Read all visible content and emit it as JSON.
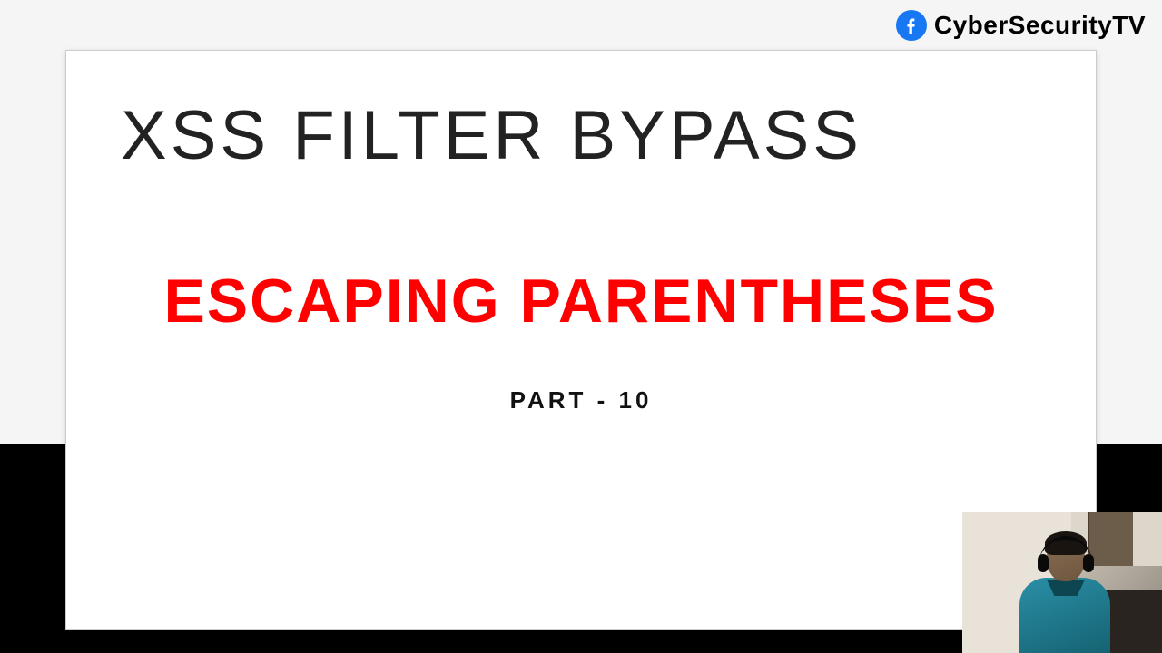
{
  "header": {
    "brand": "CyberSecurityTV",
    "icon": "facebook-icon"
  },
  "slide": {
    "title": "XSS FILTER BYPASS",
    "subtitle": "ESCAPING PARENTHESES",
    "part": "PART - 10"
  },
  "colors": {
    "accent_red": "#ff0000",
    "fb_blue": "#1877f2"
  }
}
